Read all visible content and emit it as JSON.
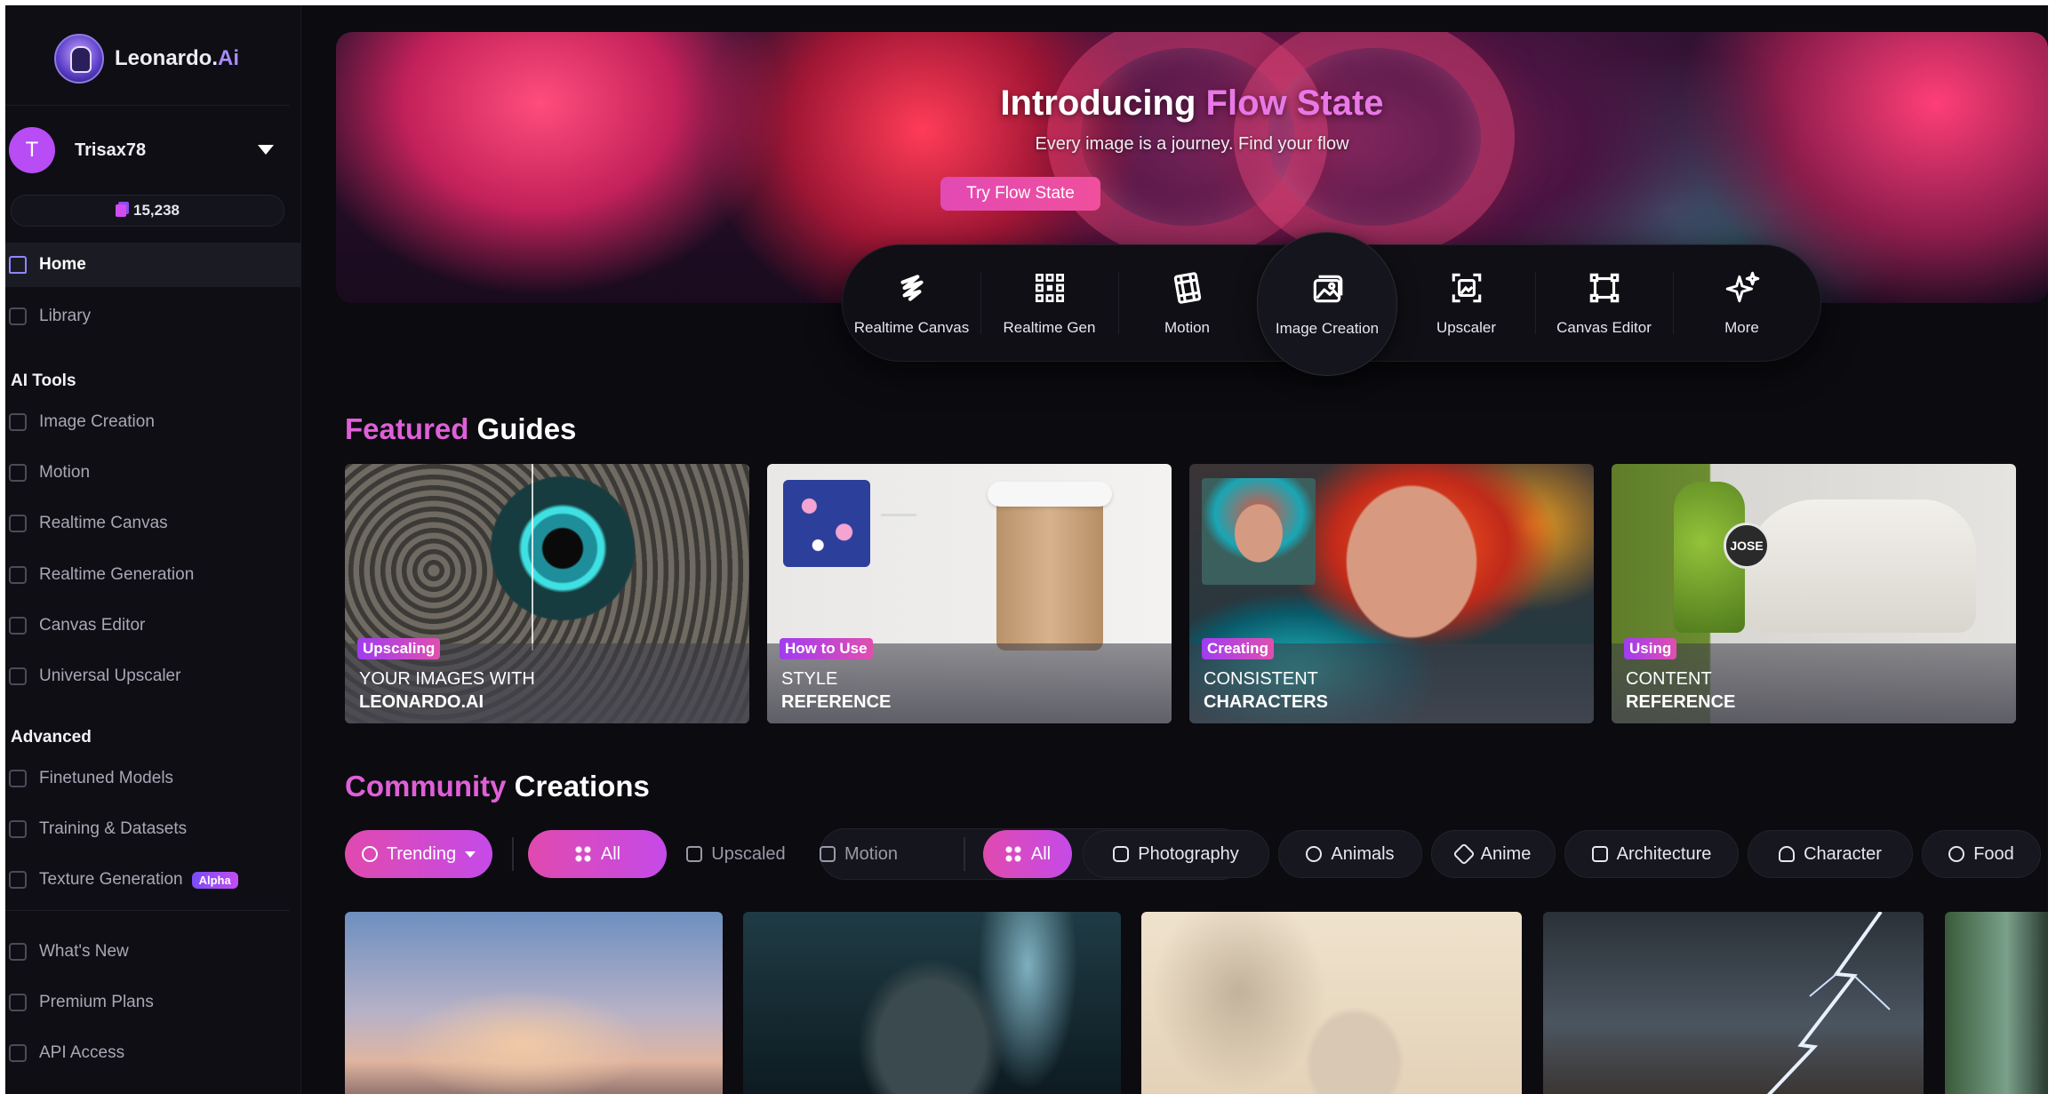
{
  "brand": {
    "name": "Leonardo.",
    "suffix": "Ai"
  },
  "user": {
    "initial": "T",
    "name": "Trisax78",
    "tokens": "15,238"
  },
  "nav": {
    "home": "Home",
    "library": "Library",
    "ai_tools_title": "AI Tools",
    "ai_tools": [
      "Image Creation",
      "Motion",
      "Realtime Canvas",
      "Realtime Generation",
      "Canvas Editor",
      "Universal Upscaler"
    ],
    "advanced_title": "Advanced",
    "advanced": [
      "Finetuned Models",
      "Training & Datasets",
      "Texture Generation"
    ],
    "alpha_badge": "Alpha",
    "bottom": [
      "What's New",
      "Premium Plans",
      "API Access"
    ]
  },
  "hero": {
    "title_main": "Introducing ",
    "title_accent": "Flow State",
    "subtitle": "Every image is a journey. Find your flow",
    "cta": "Try Flow State"
  },
  "tools": [
    "Realtime Canvas",
    "Realtime Gen",
    "Motion",
    "Image Creation",
    "Upscaler",
    "Canvas Editor",
    "More"
  ],
  "featured": {
    "title_accent": "Featured",
    "title_rest": " Guides",
    "guides": [
      {
        "badge": "Upscaling",
        "line1": "YOUR IMAGES WITH",
        "line2": "LEONARDO.AI"
      },
      {
        "badge": "How to Use",
        "line1": "STYLE",
        "line2": "REFERENCE"
      },
      {
        "badge": "Creating",
        "line1": "CONSISTENT",
        "line2": "CHARACTERS"
      },
      {
        "badge": "Using",
        "line1": "CONTENT",
        "line2": "REFERENCE"
      }
    ],
    "shoe_label": "JOSE"
  },
  "community": {
    "title_accent": "Community",
    "title_rest": " Creations",
    "sort": "Trending",
    "types": [
      "All",
      "Upscaled",
      "Motion"
    ],
    "categories": [
      "All",
      "Photography",
      "Animals",
      "Anime",
      "Architecture",
      "Character",
      "Food"
    ]
  },
  "colors": {
    "accent_pink": "#e05fd8",
    "accent_purple": "#a98bff",
    "background": "#0b0b10"
  }
}
